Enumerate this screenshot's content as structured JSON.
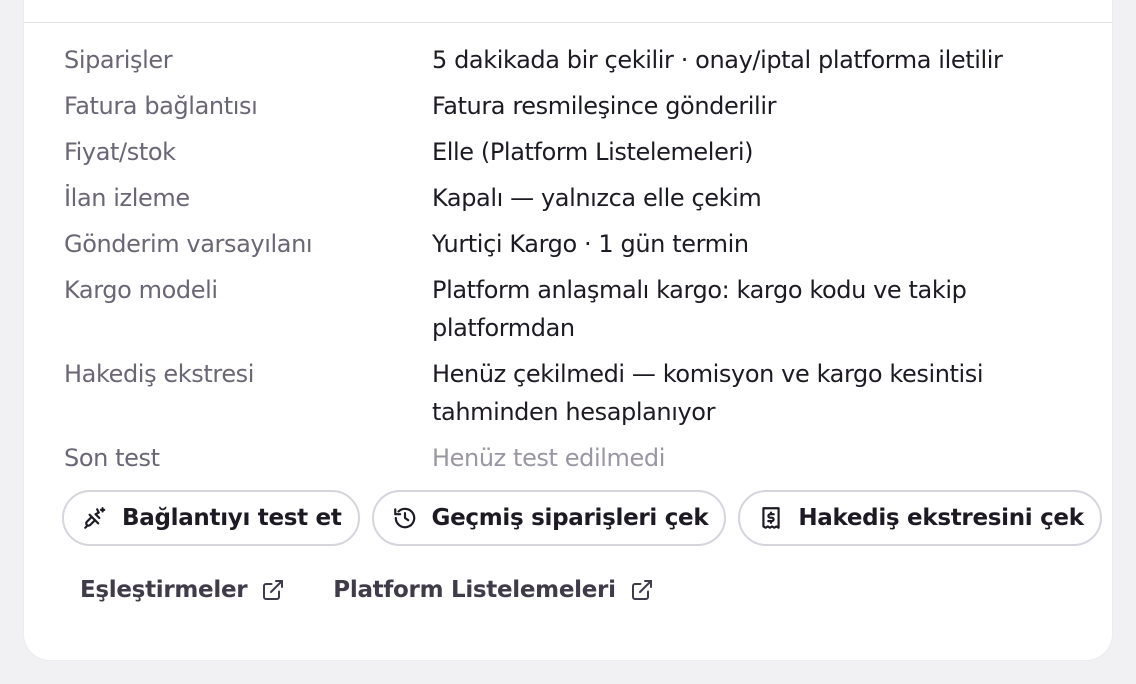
{
  "details": [
    {
      "label": "Siparişler",
      "value": "5 dakikada bir çekilir · onay/iptal platforma iletilir"
    },
    {
      "label": "Fatura bağlantısı",
      "value": "Fatura resmileşince gönderilir"
    },
    {
      "label": "Fiyat/stok",
      "value": "Elle (Platform Listelemeleri)"
    },
    {
      "label": "İlan izleme",
      "value": "Kapalı — yalnızca elle çekim"
    },
    {
      "label": "Gönderim varsayılanı",
      "value": "Yurtiçi Kargo · 1 gün termin"
    },
    {
      "label": "Kargo modeli",
      "value": "Platform anlaşmalı kargo: kargo kodu ve takip platformdan"
    },
    {
      "label": "Hakediş ekstresi",
      "value": "Henüz çekilmedi — komisyon ve kargo kesintisi tahminden hesaplanıyor"
    },
    {
      "label": "Son test",
      "value": "Henüz test edilmedi"
    }
  ],
  "actions": {
    "test_connection": {
      "label": "Bağlantıyı test et",
      "icon": "plug-icon"
    },
    "fetch_orders": {
      "label": "Geçmiş siparişleri çek",
      "icon": "history-icon"
    },
    "fetch_statement": {
      "label": "Hakediş ekstresini çek",
      "icon": "receipt-dollar-icon"
    }
  },
  "links": {
    "mappings": {
      "label": "Eşleştirmeler",
      "icon": "external-link-icon"
    },
    "listings": {
      "label": "Platform Listelemeleri",
      "icon": "external-link-icon"
    }
  },
  "colors": {
    "text": "#1d1a23",
    "muted": "#6b6676",
    "placeholder": "#9a96a3",
    "border": "#d6d4dc"
  }
}
